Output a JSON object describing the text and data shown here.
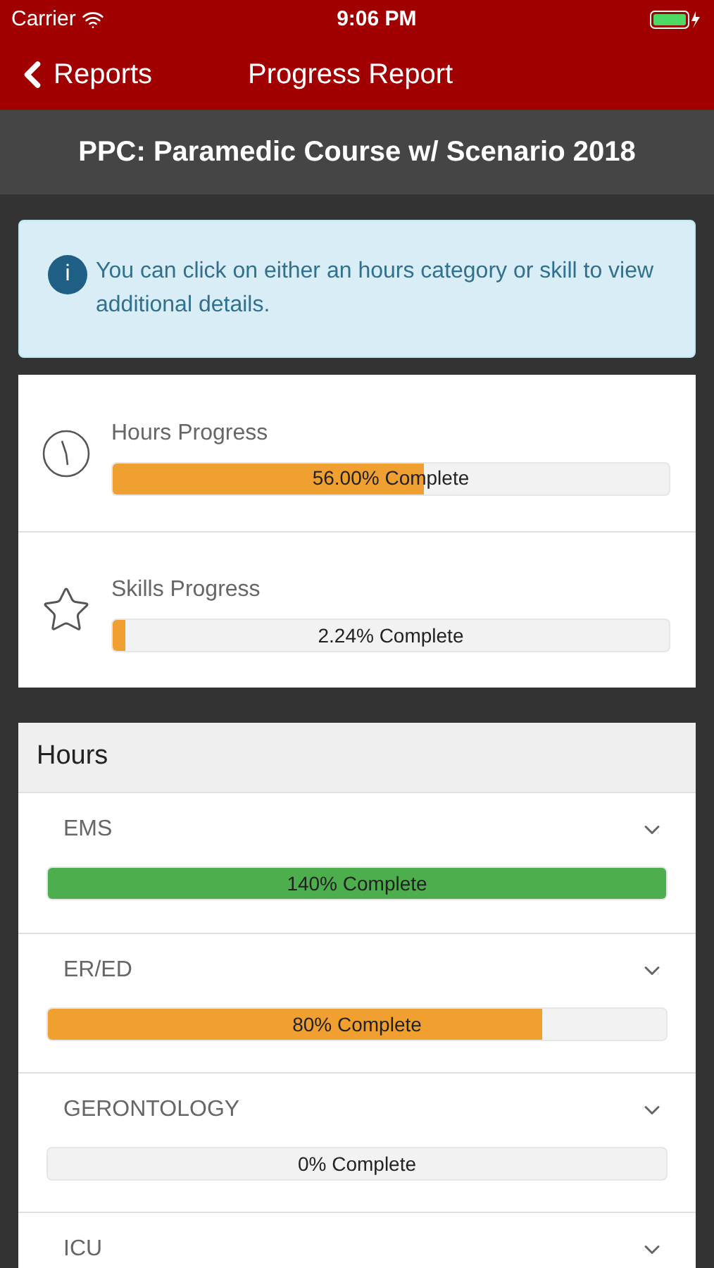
{
  "status_bar": {
    "carrier": "Carrier",
    "time": "9:06 PM"
  },
  "nav": {
    "back": "Reports",
    "title": "Progress Report"
  },
  "course_title": "PPC: Paramedic Course w/ Scenario 2018",
  "info": {
    "icon": "i",
    "text": "You can click on either an hours category or skill to view additional details."
  },
  "summary": [
    {
      "kind": "clock",
      "label": "Hours Progress",
      "level": 0.56,
      "reading": "56.00% Complete"
    },
    {
      "kind": "star",
      "label": "Skills Progress",
      "level": 0.0224,
      "reading": "2.24% Complete"
    }
  ],
  "hours": {
    "title": "Hours",
    "items": [
      {
        "name": "EMS",
        "level": 1,
        "color": "#4cae4c",
        "reading": "140% Complete"
      },
      {
        "name": "ER/ED",
        "level": 0.8,
        "color": "#f0a030",
        "reading": "80% Complete"
      },
      {
        "name": "GERONTOLOGY",
        "level": 0,
        "reading": "0% Complete"
      },
      {
        "name": "ICU"
      }
    ]
  }
}
